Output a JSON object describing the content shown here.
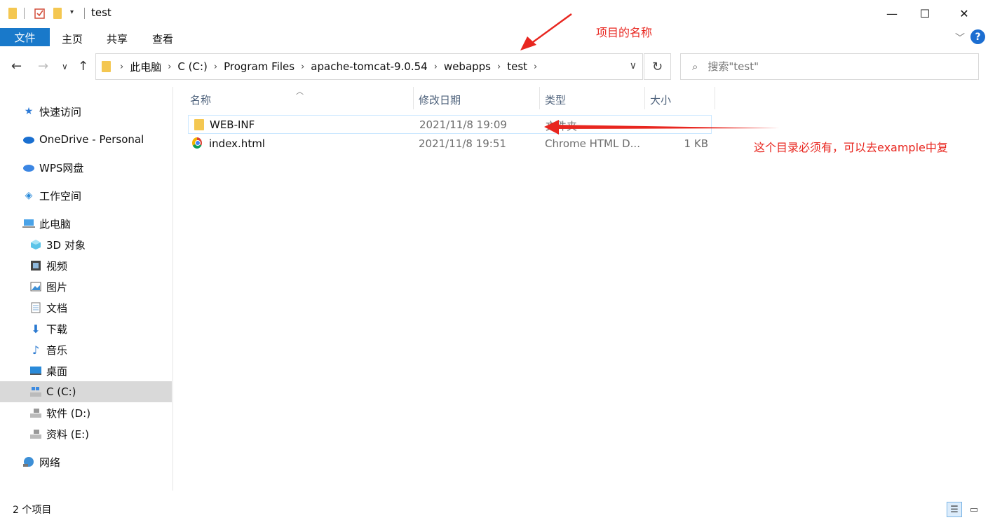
{
  "window": {
    "title": "test",
    "minimize": "—",
    "maximize": "☐",
    "close": "✕"
  },
  "ribbon": {
    "tabs": [
      "文件",
      "主页",
      "共享",
      "查看"
    ],
    "help": "?"
  },
  "address": {
    "breadcrumbs": [
      "此电脑",
      "C (C:)",
      "Program Files",
      "apache-tomcat-9.0.54",
      "webapps",
      "test"
    ]
  },
  "search": {
    "placeholder": "搜索\"test\""
  },
  "sidebar": {
    "items": [
      {
        "label": "快速访问",
        "icon": "star-icon"
      },
      {
        "label": "OneDrive - Personal",
        "icon": "cloud-icon"
      },
      {
        "label": "WPS网盘",
        "icon": "wps-cloud-icon"
      },
      {
        "label": "工作空间",
        "icon": "workspace-icon"
      },
      {
        "label": "此电脑",
        "icon": "computer-icon"
      },
      {
        "label": "3D 对象",
        "icon": "cube-icon"
      },
      {
        "label": "视频",
        "icon": "video-icon"
      },
      {
        "label": "图片",
        "icon": "picture-icon"
      },
      {
        "label": "文档",
        "icon": "document-icon"
      },
      {
        "label": "下载",
        "icon": "download-icon"
      },
      {
        "label": "音乐",
        "icon": "music-icon"
      },
      {
        "label": "桌面",
        "icon": "desktop-icon"
      },
      {
        "label": "C (C:)",
        "icon": "drive-c-icon"
      },
      {
        "label": "软件 (D:)",
        "icon": "drive-icon"
      },
      {
        "label": "资料 (E:)",
        "icon": "drive-icon"
      },
      {
        "label": "网络",
        "icon": "network-icon"
      }
    ]
  },
  "columns": {
    "name": "名称",
    "date": "修改日期",
    "type": "类型",
    "size": "大小"
  },
  "files": [
    {
      "name": "WEB-INF",
      "date": "2021/11/8 19:09",
      "type": "文件夹",
      "size": ""
    },
    {
      "name": "index.html",
      "date": "2021/11/8 19:51",
      "type": "Chrome HTML D...",
      "size": "1 KB"
    }
  ],
  "annotations": {
    "project_name": "项目的名称",
    "directory_note": "这个目录必须有，可以去example中复"
  },
  "status": {
    "item_count": "2 个项目"
  },
  "colors": {
    "accent": "#1979ca",
    "annotation": "#e8261f",
    "header_text": "#4c607a"
  }
}
